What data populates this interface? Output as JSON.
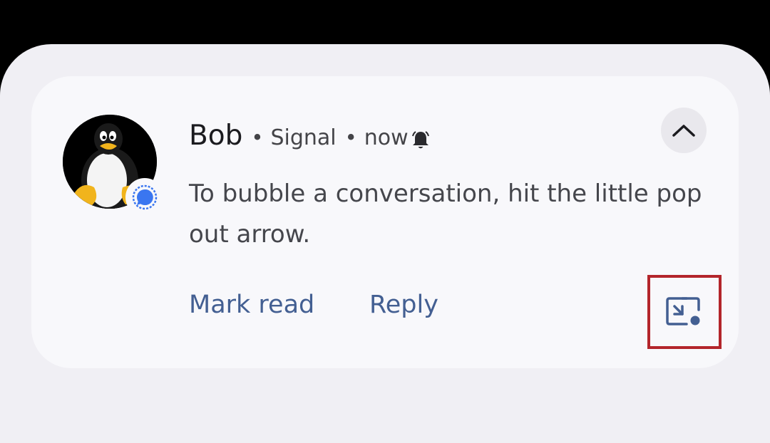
{
  "notification": {
    "sender": "Bob",
    "separator": "•",
    "app_name": "Signal",
    "time": "now",
    "message": "To bubble a conversation, hit the little pop out arrow.",
    "actions": {
      "mark_read": "Mark read",
      "reply": "Reply"
    }
  },
  "icons": {
    "avatar": "tux-penguin-avatar",
    "app_badge": "signal-chat-icon",
    "alert": "bell-icon",
    "expand": "chevron-up-icon",
    "bubble": "bubble-popout-icon"
  },
  "colors": {
    "action_text": "#435f92",
    "highlight_border": "#b3252b",
    "signal_blue": "#3a76f0"
  }
}
